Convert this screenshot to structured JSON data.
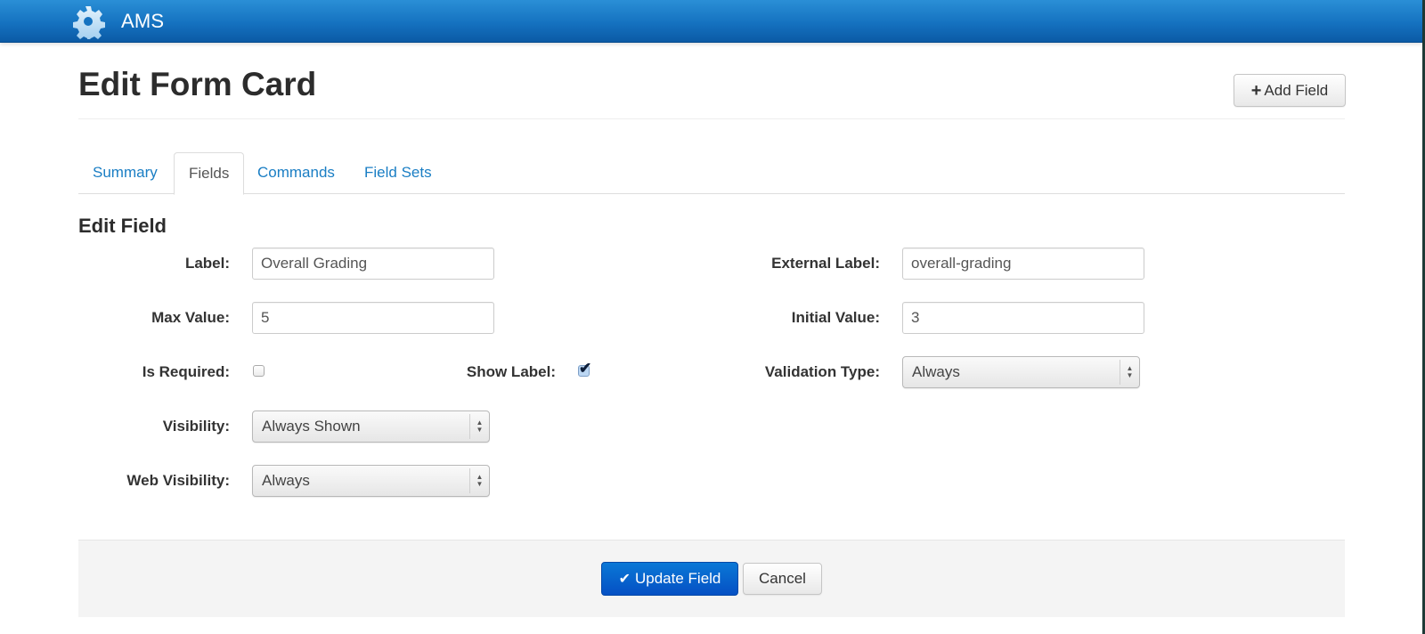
{
  "app": {
    "brand_name": "AMS",
    "brand_icon": "gear-speech-icon",
    "navbar_color": "#1572c0"
  },
  "page": {
    "title": "Edit Form Card",
    "add_field_button": {
      "icon": "plus-icon",
      "label": "Add Field"
    }
  },
  "tabs": [
    {
      "label": "Summary",
      "active": false
    },
    {
      "label": "Fields",
      "active": true
    },
    {
      "label": "Commands",
      "active": false
    },
    {
      "label": "Field Sets",
      "active": false
    }
  ],
  "form": {
    "section_title": "Edit Field",
    "label": {
      "label": "Label:",
      "value": "Overall Grading"
    },
    "external_label": {
      "label": "External Label:",
      "value": "overall-grading"
    },
    "max_value": {
      "label": "Max Value:",
      "value": "5"
    },
    "initial_value": {
      "label": "Initial Value:",
      "value": "3"
    },
    "is_required": {
      "label": "Is Required:",
      "checked": false
    },
    "show_label": {
      "label": "Show Label:",
      "checked": true
    },
    "validation_type": {
      "label": "Validation Type:",
      "selected": "Always"
    },
    "visibility": {
      "label": "Visibility:",
      "selected": "Always Shown"
    },
    "web_visibility": {
      "label": "Web Visibility:",
      "selected": "Always"
    }
  },
  "actions": {
    "update": {
      "icon": "check-icon",
      "label": "Update Field",
      "color": "#0a66cf"
    },
    "cancel": {
      "label": "Cancel"
    }
  }
}
